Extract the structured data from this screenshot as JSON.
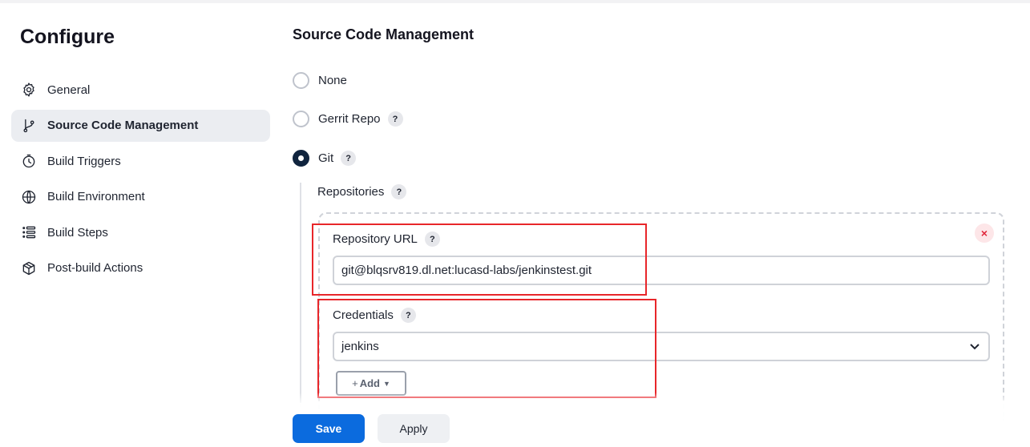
{
  "page": {
    "title": "Configure"
  },
  "sidebar": {
    "items": [
      {
        "label": "General",
        "icon": "gear-icon",
        "active": false
      },
      {
        "label": "Source Code Management",
        "icon": "git-branch-icon",
        "active": true
      },
      {
        "label": "Build Triggers",
        "icon": "timer-icon",
        "active": false
      },
      {
        "label": "Build Environment",
        "icon": "globe-icon",
        "active": false
      },
      {
        "label": "Build Steps",
        "icon": "list-icon",
        "active": false
      },
      {
        "label": "Post-build Actions",
        "icon": "package-icon",
        "active": false
      }
    ]
  },
  "scm": {
    "title": "Source Code Management",
    "options": [
      {
        "label": "None",
        "checked": false,
        "help": false
      },
      {
        "label": "Gerrit Repo",
        "checked": false,
        "help": true
      },
      {
        "label": "Git",
        "checked": true,
        "help": true
      }
    ],
    "help_glyph": "?",
    "repositories_label": "Repositories",
    "repository_url_label": "Repository URL",
    "repository_url_value": "git@blqsrv819.dl.net:lucasd-labs/jenkinstest.git",
    "credentials_label": "Credentials",
    "credentials_value": "jenkins",
    "add_label": "Add",
    "remove_glyph": "×"
  },
  "footer": {
    "save_label": "Save",
    "apply_label": "Apply"
  },
  "colors": {
    "primary": "#0b6bde",
    "highlight": "#e8262a",
    "radio_checked": "#10243e"
  }
}
